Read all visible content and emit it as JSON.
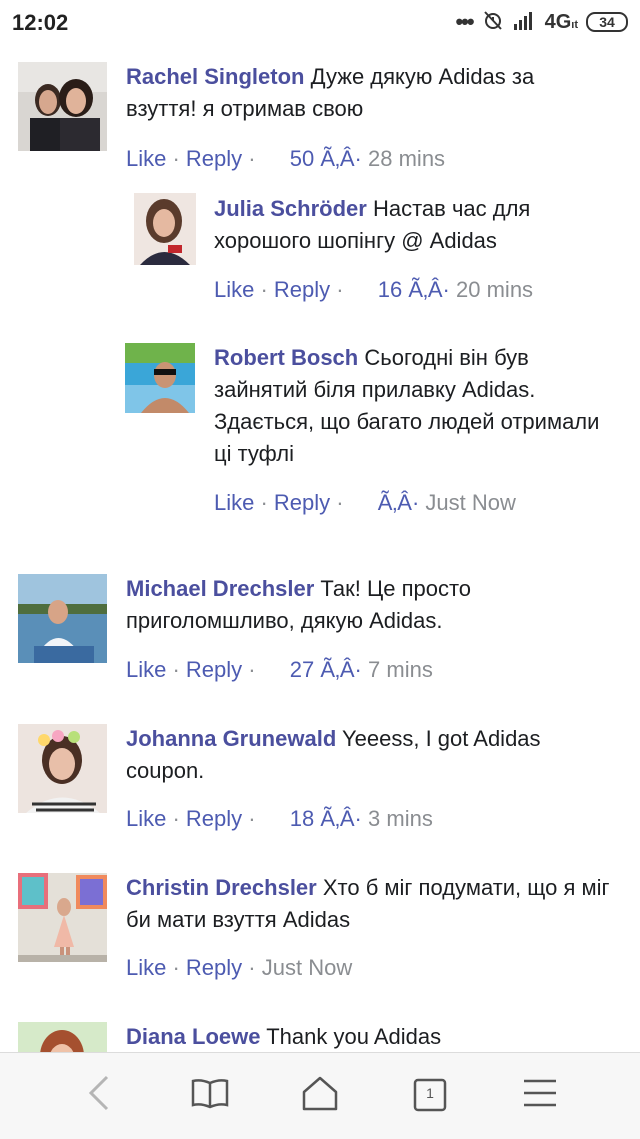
{
  "status": {
    "time": "12:02",
    "network": "4G",
    "network_sub": "ıt",
    "battery": "34",
    "dots": "•••"
  },
  "comments": [
    {
      "name": "Rachel Singleton",
      "text": " Дуже дякую Adidas за взуття! я отримав свою",
      "like": "Like",
      "reply": "Reply",
      "count": "50 Ã‚Â·",
      "time": "28 mins"
    },
    {
      "name": "Julia Schröder",
      "text": " Настав час для хорошого шопінгу @ Adidas",
      "like": "Like",
      "reply": "Reply",
      "count": "16 Ã‚Â·",
      "time": "20 mins"
    },
    {
      "name": "Robert Bosch",
      "text": " Сьогодні він був зайнятий біля прилавку Adidas. Здається, що багато людей отримали ці туфлі",
      "like": "Like",
      "reply": "Reply",
      "count": "Ã‚Â·",
      "time": "Just Now"
    },
    {
      "name": "Michael Drechsler",
      "text": " Так! Це просто приголомшливо, дякую Adidas.",
      "like": "Like",
      "reply": "Reply",
      "count": "27 Ã‚Â·",
      "time": "7 mins"
    },
    {
      "name": "Johanna Grunewald",
      "text": " Yeeess, I got Adidas coupon.",
      "like": "Like",
      "reply": "Reply",
      "count": "18 Ã‚Â·",
      "time": "3 mins"
    },
    {
      "name": "Christin Drechsler",
      "text": " Хто б міг подумати, що я міг би мати взуття Adidas",
      "like": "Like",
      "reply": "Reply",
      "count": "",
      "time": "Just Now"
    },
    {
      "name": "Diana Loewe",
      "text": " Thank you Adidas"
    }
  ],
  "nav": {
    "tabs_count": "1",
    "icons": [
      "back-icon",
      "bookmarks-icon",
      "home-icon",
      "tabs-icon",
      "menu-icon"
    ]
  }
}
